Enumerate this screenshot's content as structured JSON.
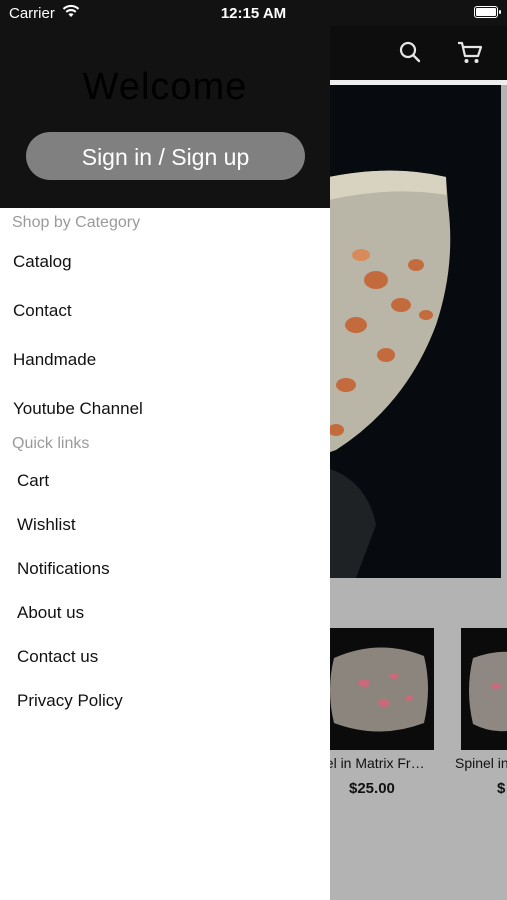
{
  "status_bar": {
    "carrier": "Carrier",
    "time": "12:15 AM"
  },
  "header": {
    "cart_count": "0",
    "icons": [
      "search-icon",
      "cart-icon"
    ]
  },
  "drawer": {
    "welcome": "Welcome",
    "signin_label": "Sign in / Sign up",
    "category_title": "Shop by Category",
    "categories": [
      "Catalog",
      "Contact",
      "Handmade",
      "Youtube Channel"
    ],
    "quick_links_title": "Quick links",
    "quick_links": [
      "Cart",
      "Wishlist",
      "Notifications",
      "About us",
      "Contact us",
      "Privacy Policy"
    ]
  },
  "products": [
    {
      "name": "nel in Matrix Fr…",
      "price": "$25.00"
    },
    {
      "name": "Spinel in",
      "price": "$"
    }
  ],
  "colors": {
    "badge": "#c2185b",
    "drawer_header": "#121212",
    "signin_button": "#808080"
  }
}
